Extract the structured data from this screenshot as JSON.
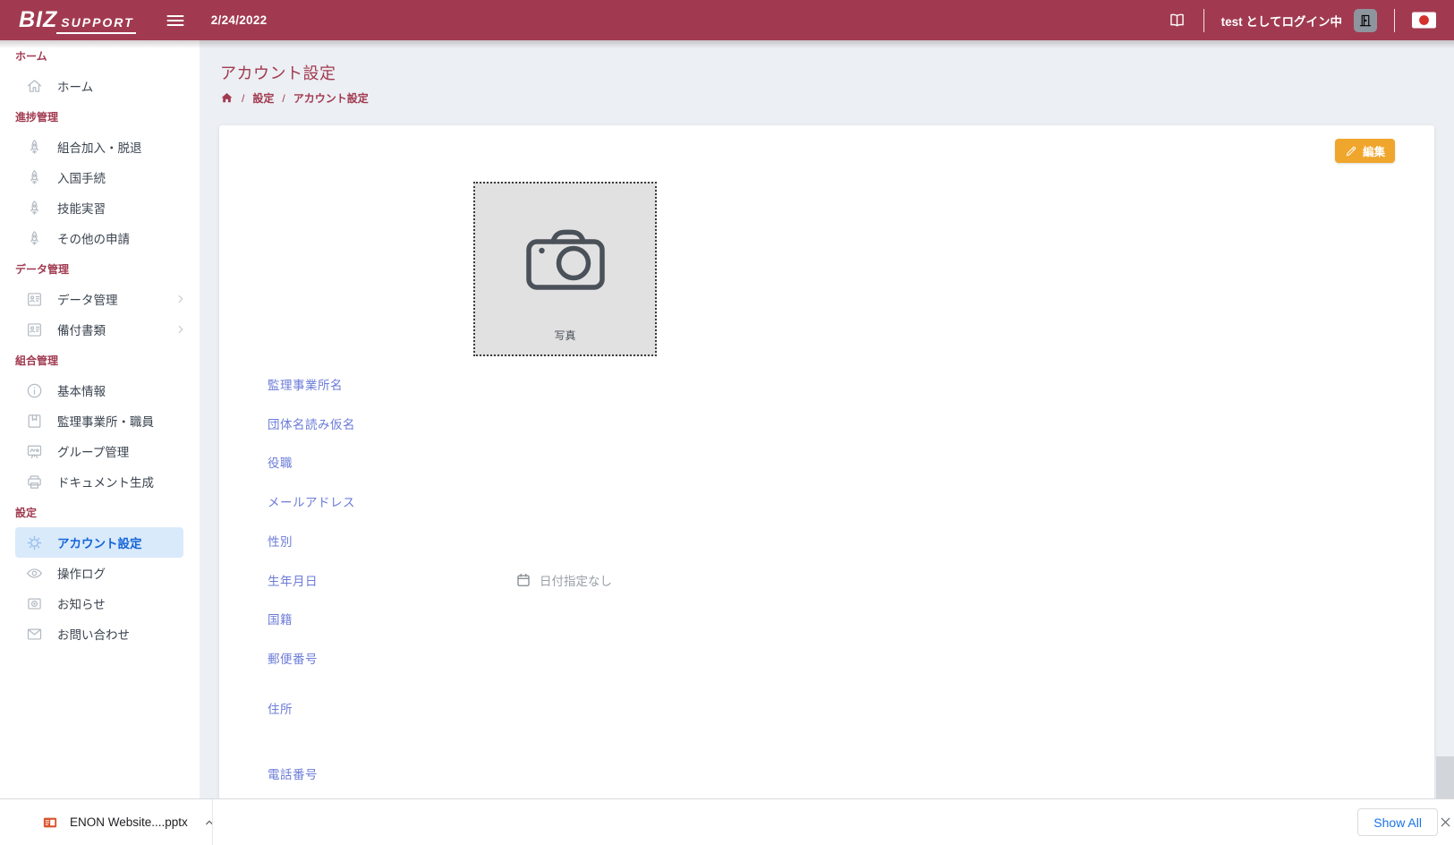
{
  "header": {
    "logo_primary": "BIZ",
    "logo_secondary": "SUPPORT",
    "date": "2/24/2022",
    "login_status": "test としてログイン中"
  },
  "sidebar": {
    "sections": [
      {
        "label": "ホーム",
        "items": [
          {
            "label": "ホーム",
            "icon": "home-icon"
          }
        ]
      },
      {
        "label": "進捗管理",
        "items": [
          {
            "label": "組合加入・脱退",
            "icon": "rocket-icon"
          },
          {
            "label": "入国手続",
            "icon": "rocket-icon"
          },
          {
            "label": "技能実習",
            "icon": "rocket-icon"
          },
          {
            "label": "その他の申請",
            "icon": "rocket-icon"
          }
        ]
      },
      {
        "label": "データ管理",
        "items": [
          {
            "label": "データ管理",
            "icon": "id-card-icon",
            "chevron": true
          },
          {
            "label": "備付書類",
            "icon": "id-card-icon",
            "chevron": true
          }
        ]
      },
      {
        "label": "組合管理",
        "items": [
          {
            "label": "基本情報",
            "icon": "info-icon"
          },
          {
            "label": "監理事業所・職員",
            "icon": "notebook-icon"
          },
          {
            "label": "グループ管理",
            "icon": "presentation-icon"
          },
          {
            "label": "ドキュメント生成",
            "icon": "printer-icon"
          }
        ]
      },
      {
        "label": "設定",
        "items": [
          {
            "label": "アカウント設定",
            "icon": "gear-icon",
            "active": true
          },
          {
            "label": "操作ログ",
            "icon": "eye-icon"
          },
          {
            "label": "お知らせ",
            "icon": "announcement-icon"
          },
          {
            "label": "お問い合わせ",
            "icon": "mail-icon"
          }
        ]
      }
    ]
  },
  "main": {
    "page_title": "アカウント設定",
    "breadcrumb": {
      "items": [
        "設定",
        "アカウント設定"
      ],
      "separator": "/"
    },
    "edit_button_label": "編集",
    "photo_placeholder_label": "写真",
    "fields": [
      {
        "label": "監理事業所名",
        "value": ""
      },
      {
        "label": "団体名読み仮名",
        "value": ""
      },
      {
        "label": "役職",
        "value": ""
      },
      {
        "label": "メールアドレス",
        "value": ""
      },
      {
        "label": "性別",
        "value": ""
      },
      {
        "label": "生年月日",
        "value": "",
        "placeholder": "日付指定なし",
        "icon": "calendar-icon"
      },
      {
        "label": "国籍",
        "value": ""
      },
      {
        "label": "郵便番号",
        "value": ""
      },
      {
        "label": "住所",
        "value": ""
      },
      {
        "label": "電話番号",
        "value": ""
      }
    ]
  },
  "download_bar": {
    "file_name": "ENON Website....pptx",
    "show_all_label": "Show All"
  },
  "colors": {
    "brand_maroon": "#A13A50",
    "accent_orange": "#F0A62C",
    "active_blue": "#1565D8",
    "field_label_blue": "#6C7CD8",
    "flag_red": "#D4302E",
    "photo_bg": "#E1E1E2"
  }
}
